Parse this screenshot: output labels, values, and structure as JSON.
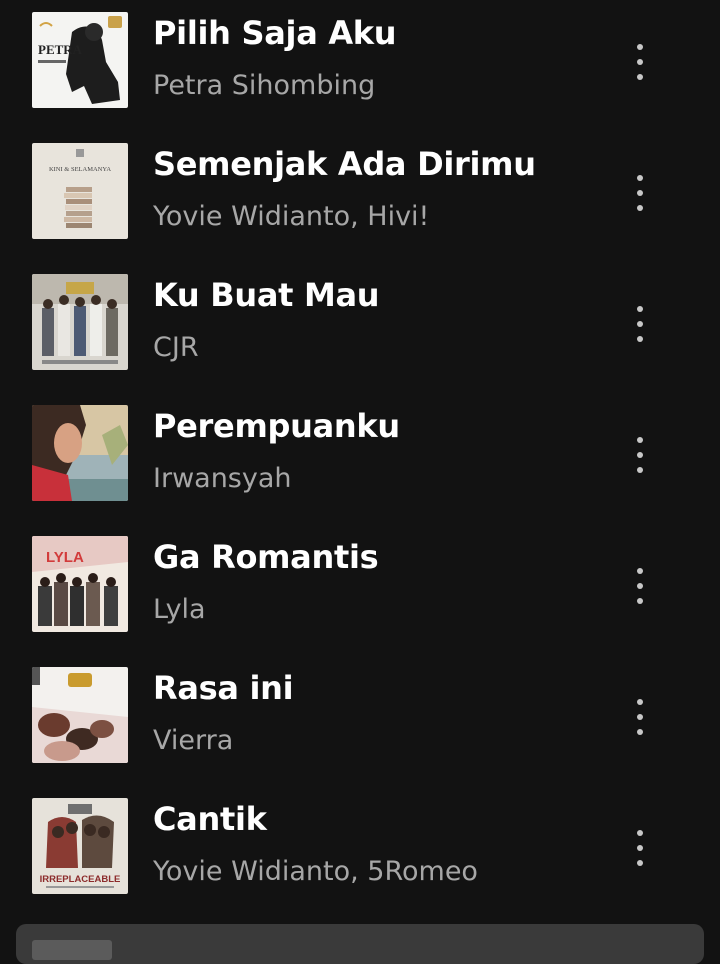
{
  "tracks": [
    {
      "title": "Pilih Saja Aku",
      "artist": "Petra Sihombing",
      "cover_text": "PETRA"
    },
    {
      "title": "Semenjak Ada Dirimu",
      "artist": "Yovie Widianto, Hivi!",
      "cover_text": "KINI & SELAMANYA"
    },
    {
      "title": "Ku Buat Mau",
      "artist": "CJR",
      "cover_text": ""
    },
    {
      "title": "Perempuanku",
      "artist": "Irwansyah",
      "cover_text": ""
    },
    {
      "title": "Ga Romantis",
      "artist": "Lyla",
      "cover_text": "LYLA"
    },
    {
      "title": "Rasa ini",
      "artist": "Vierra",
      "cover_text": ""
    },
    {
      "title": "Cantik",
      "artist": "Yovie Widianto, 5Romeo",
      "cover_text": "IRREPLACEABLE"
    }
  ],
  "icons": {
    "more": "more-vert-icon"
  },
  "colors": {
    "background": "#121212",
    "title": "#ffffff",
    "subtitle": "#a7a7a7",
    "mini_player": "#3a3a3a"
  }
}
